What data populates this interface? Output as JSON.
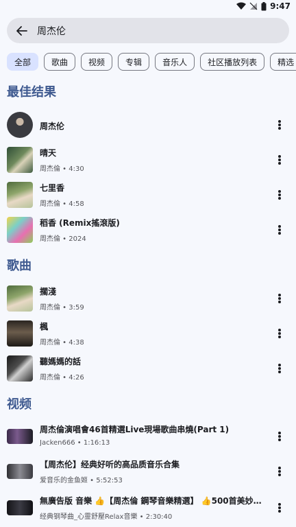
{
  "status": {
    "time": "9:47"
  },
  "search": {
    "query": "周杰伦"
  },
  "chips": [
    "全部",
    "歌曲",
    "视频",
    "专辑",
    "音乐人",
    "社区播放列表",
    "精选"
  ],
  "sections": {
    "top": "最佳结果",
    "songs": "歌曲",
    "videos": "视频"
  },
  "top_results": [
    {
      "title": "周杰伦",
      "subtitle": ""
    },
    {
      "title": "晴天",
      "subtitle": "周杰倫 • 4:30"
    },
    {
      "title": "七里香",
      "subtitle": "周杰倫 • 4:58"
    },
    {
      "title": "稻香 (Remix搖滾版)",
      "subtitle": "周杰倫 • 2024"
    }
  ],
  "songs": [
    {
      "title": "擱淺",
      "subtitle": "周杰倫 • 3:59"
    },
    {
      "title": "楓",
      "subtitle": "周杰倫 • 4:38"
    },
    {
      "title": "聽媽媽的話",
      "subtitle": "周杰倫 • 4:26"
    }
  ],
  "videos": [
    {
      "title": "周杰倫演唱會46首精選Live現場歌曲串燒(Part 1)",
      "subtitle": "Jacken666 • 1:16:13"
    },
    {
      "title": "【周杰伦】经典好听的高品质音乐合集",
      "subtitle": "爱音乐的金鱼姬 • 5:52:53"
    },
    {
      "title": "無廣告版 音樂 👍【周杰倫 鋼琴音樂精選】 👍500首美妙的…",
      "subtitle": "经典钢琴曲_心靈舒壓Relax音樂 • 2:30:40"
    }
  ],
  "colors": {
    "accent": "#3f5a90",
    "chip_selected": "#d9e2ff",
    "background": "#f6f8fd"
  }
}
